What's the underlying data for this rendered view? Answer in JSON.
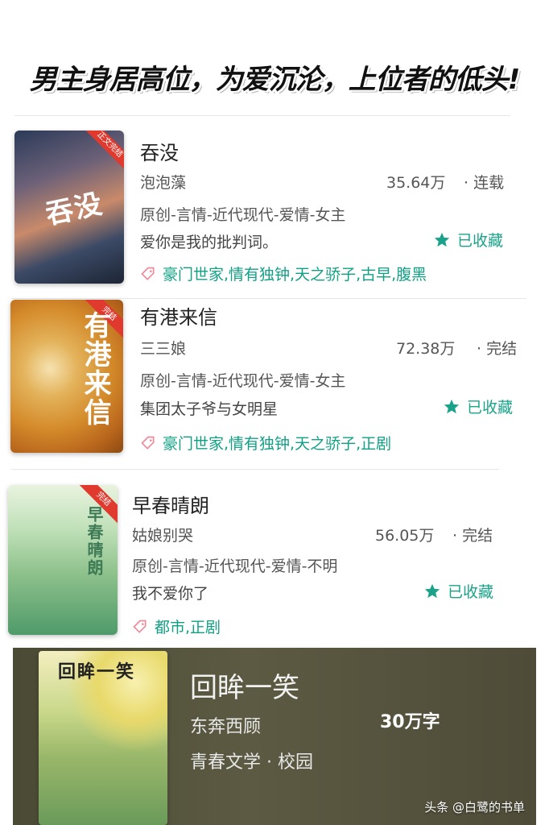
{
  "banner": {
    "text": "男主身居高位，为爱沉沦，上位者的低头!"
  },
  "books": [
    {
      "title": "吞没",
      "author": "泡泡藻",
      "words": "35.64万",
      "status": "· 连载",
      "category": "原创-言情-近代现代-爱情-女主",
      "intro": "爱你是我的批判词。",
      "collect_label": "已收藏",
      "tags": "豪门世家,情有独钟,天之骄子,古早,腹黑",
      "cover": {
        "ribbon": "正文完结",
        "art_title": "吞没",
        "colors": [
          "#2b3b58",
          "#8a6a78",
          "#c98a6a",
          "#1d2535"
        ]
      }
    },
    {
      "title": "有港来信",
      "author": "三三娘",
      "words": "72.38万",
      "status": "· 完结",
      "category": "原创-言情-近代现代-爱情-女主",
      "intro": "集团太子爷与女明星",
      "collect_label": "已收藏",
      "tags": "豪门世家,情有独钟,天之骄子,正剧",
      "cover": {
        "ribbon": "完结",
        "art_title": "有港来信",
        "colors": [
          "#d48a2a",
          "#e3b25a",
          "#b8651c",
          "#f2d28a"
        ]
      }
    },
    {
      "title": "早春晴朗",
      "author": "姑娘别哭",
      "words": "56.05万",
      "status": "· 完结",
      "category": "原创-言情-近代现代-爱情-不明",
      "intro": "我不爱你了",
      "collect_label": "已收藏",
      "tags": "都市,正剧",
      "cover": {
        "ribbon": "完结",
        "art_title": "早春晴朗",
        "colors": [
          "#cfe6c8",
          "#8cc08a",
          "#4f9a6a",
          "#e9f3df"
        ]
      }
    }
  ],
  "last_book": {
    "title": "回眸一笑",
    "author": "东奔西顾",
    "words": "30万字",
    "category": "青春文学 · 校园",
    "cover": {
      "art_title": "回眸一笑",
      "colors": [
        "#e8d96a",
        "#9bb86a",
        "#6a9a5a",
        "#f4eec0"
      ]
    }
  },
  "watermark": "头条 @白鹭的书单",
  "colors": {
    "accent": "#1aa38a",
    "tag_text": "#12a085",
    "tag_icon": "#f08a9a",
    "ribbon": "#e03a2f"
  }
}
